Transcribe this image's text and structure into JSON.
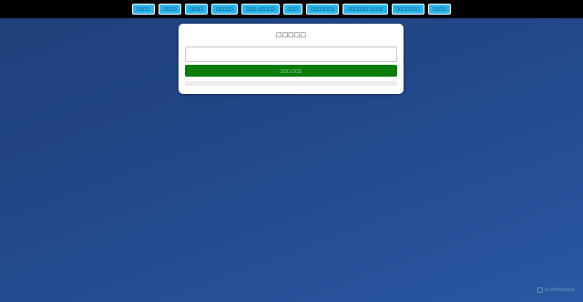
{
  "nav": {
    "items": [
      {
        "label": "□□□□"
      },
      {
        "label": "□□□□"
      },
      {
        "label": "□□□□"
      },
      {
        "label": "□□□□□"
      },
      {
        "label": "□□□ □□□□□"
      },
      {
        "label": "□□□"
      },
      {
        "label": "□□□□□□□"
      },
      {
        "label": "□□□□□□ □□□□"
      },
      {
        "label": "□□□□□□□"
      },
      {
        "label": "□□□□"
      }
    ]
  },
  "card": {
    "title": "□□□□□",
    "textarea_value": "",
    "textarea_placeholder": "",
    "submit_label": "□□□ □□□",
    "result_text": ""
  },
  "watermark": {
    "text": "ScanMalware",
    "icon": "scanmalware-logo-icon"
  },
  "colors": {
    "nav_button": "#29b6ee",
    "submit_button": "#0a7d0a",
    "topbar": "#000000",
    "background": "#23478a"
  }
}
